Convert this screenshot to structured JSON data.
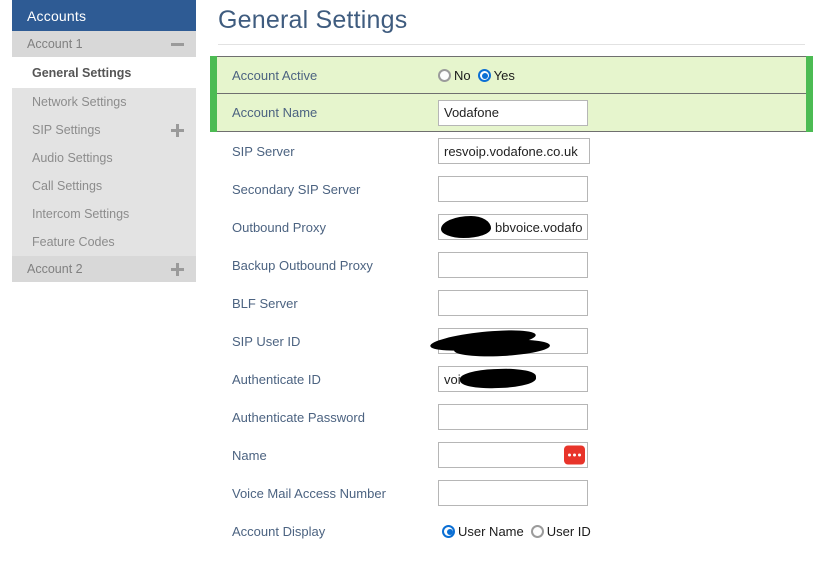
{
  "sidebar": {
    "header": "Accounts",
    "groups": [
      {
        "label": "Account 1",
        "icon": "minus-icon"
      },
      {
        "label": "Account 2",
        "icon": "plus-icon"
      }
    ],
    "active_item": "General Settings",
    "items": [
      {
        "label": "Network Settings",
        "icon": ""
      },
      {
        "label": "SIP Settings",
        "icon": "plus-icon"
      },
      {
        "label": "Audio Settings",
        "icon": ""
      },
      {
        "label": "Call Settings",
        "icon": ""
      },
      {
        "label": "Intercom Settings",
        "icon": ""
      },
      {
        "label": "Feature Codes",
        "icon": ""
      }
    ]
  },
  "main": {
    "title": "General Settings",
    "rows": {
      "account_active": {
        "label": "Account Active",
        "option_no": "No",
        "option_yes": "Yes",
        "selected": "Yes"
      },
      "account_name": {
        "label": "Account Name",
        "value": "Vodafone"
      },
      "sip_server": {
        "label": "SIP Server",
        "value": "resvoip.vodafone.co.uk"
      },
      "secondary_sip_server": {
        "label": "Secondary SIP Server",
        "value": ""
      },
      "outbound_proxy": {
        "label": "Outbound Proxy",
        "value": "bbvoice.vodafone",
        "redacted": true
      },
      "backup_outbound_proxy": {
        "label": "Backup Outbound Proxy",
        "value": ""
      },
      "blf_server": {
        "label": "BLF Server",
        "value": ""
      },
      "sip_user_id": {
        "label": "SIP User ID",
        "value": "",
        "redacted": true
      },
      "authenticate_id": {
        "label": "Authenticate ID",
        "value": "voi",
        "redacted": true
      },
      "authenticate_password": {
        "label": "Authenticate Password",
        "value": ""
      },
      "name": {
        "label": "Name",
        "value": "",
        "badge_icon": "ellipsis-badge-icon"
      },
      "voice_mail_access_number": {
        "label": "Voice Mail Access Number",
        "value": ""
      },
      "account_display": {
        "label": "Account Display",
        "option_user_name": "User Name",
        "option_user_id": "User ID",
        "selected": "User Name"
      }
    }
  },
  "colors": {
    "sidebar_header": "#2e5b94",
    "highlight_row": "#e6f5cd",
    "highlight_bar": "#4cbb53",
    "label_text": "#4c6381",
    "title_text": "#3f5c7f",
    "badge_red": "#e8342a",
    "radio_blue": "#0b6fd4"
  }
}
